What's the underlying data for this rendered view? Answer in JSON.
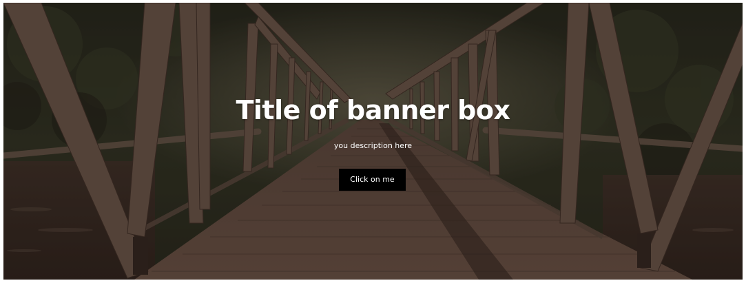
{
  "banner": {
    "title": "Title of banner box",
    "description": "you description here",
    "button_label": "Click on me"
  },
  "colors": {
    "button_background": "#000000",
    "button_text": "#ffffff",
    "title_text": "#ffffff",
    "overlay": "#231612"
  }
}
